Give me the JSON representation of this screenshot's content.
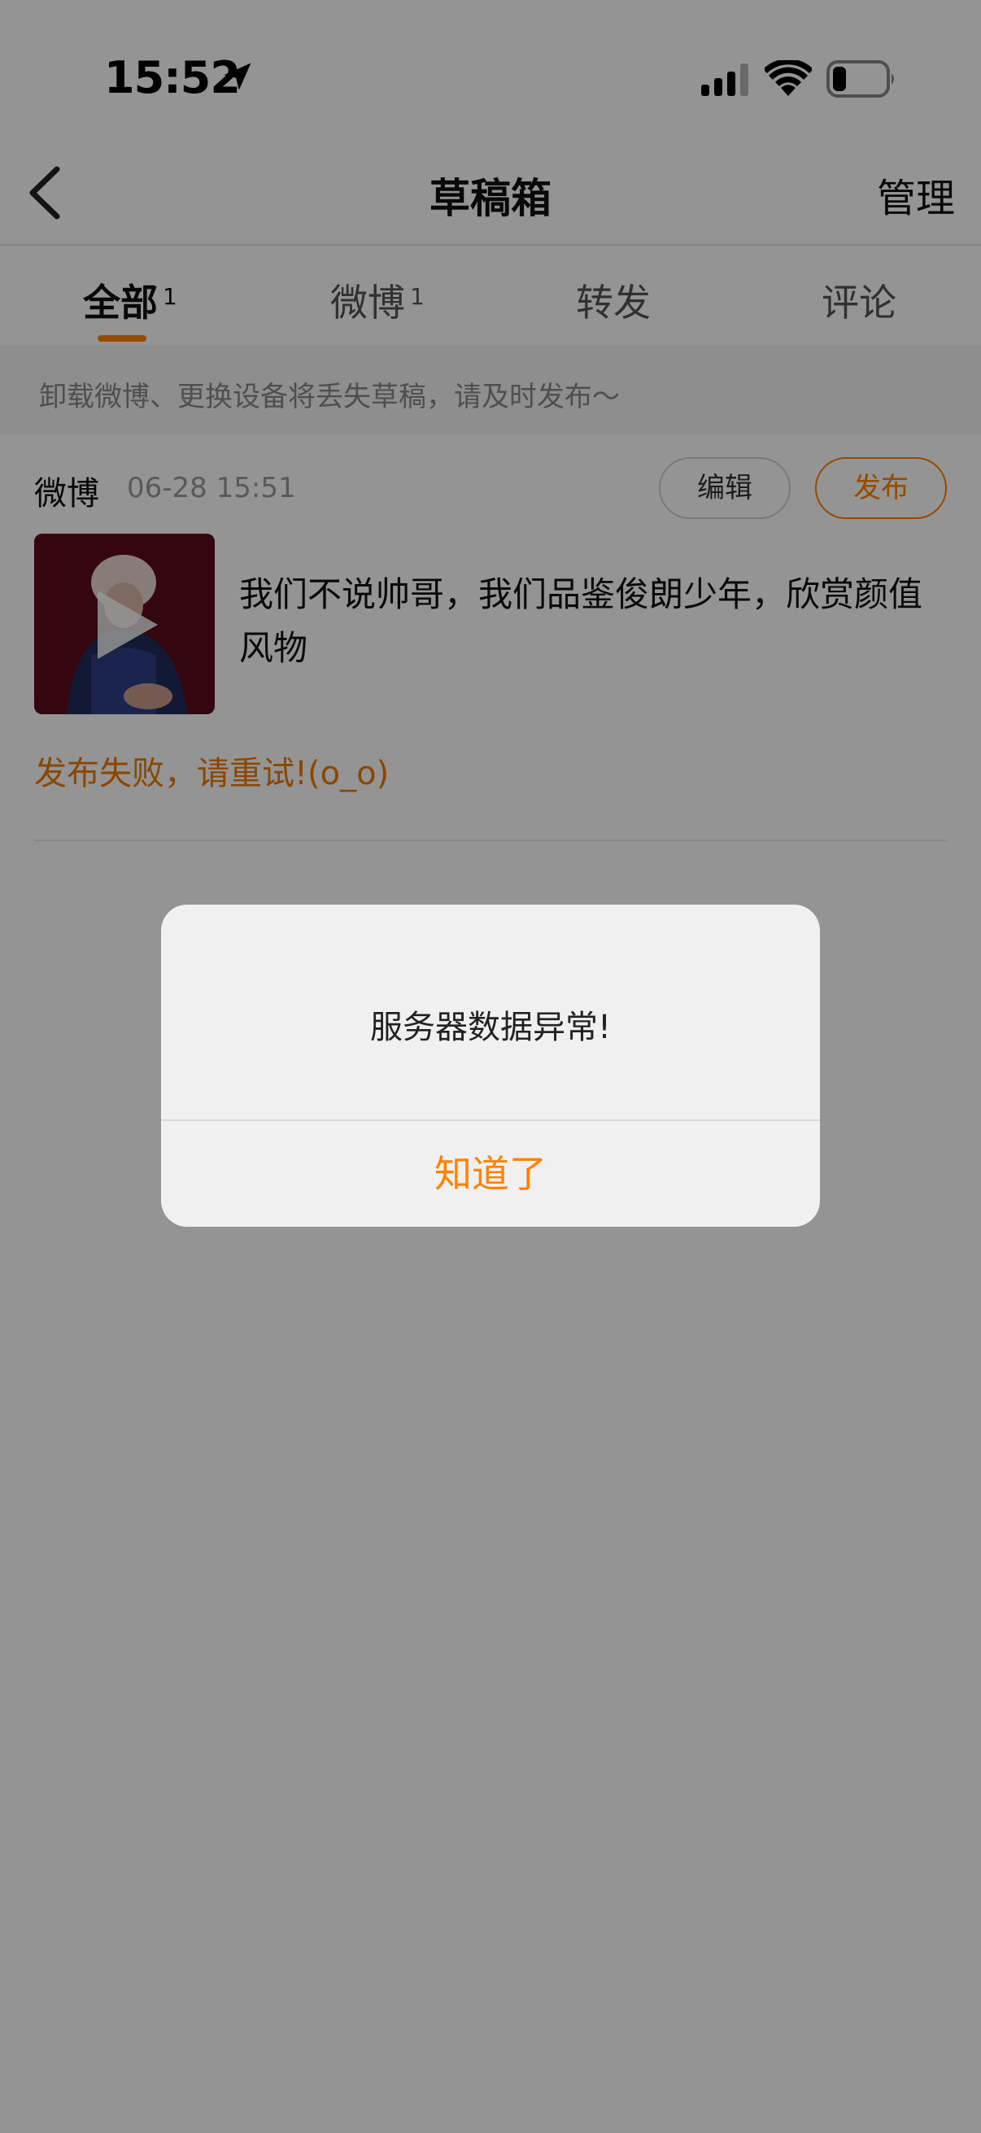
{
  "status_bar": {
    "time": "15:52"
  },
  "nav": {
    "title": "草稿箱",
    "manage_label": "管理"
  },
  "tabs": [
    {
      "label": "全部",
      "count": "1",
      "active": true
    },
    {
      "label": "微博",
      "count": "1"
    },
    {
      "label": "转发",
      "count": ""
    },
    {
      "label": "评论",
      "count": ""
    }
  ],
  "notice": "卸载微博、更换设备将丢失草稿，请及时发布～",
  "draft": {
    "type": "微博",
    "time": "06-28 15:51",
    "edit_label": "编辑",
    "publish_label": "发布",
    "text": "我们不说帅哥，我们品鉴俊朗少年，欣赏颜值风物",
    "status": "发布失败，请重试!(o_o)"
  },
  "dialog": {
    "message": "服务器数据异常!",
    "button": "知道了"
  },
  "colors": {
    "accent": "#ff8200",
    "error": "#f07a00"
  }
}
